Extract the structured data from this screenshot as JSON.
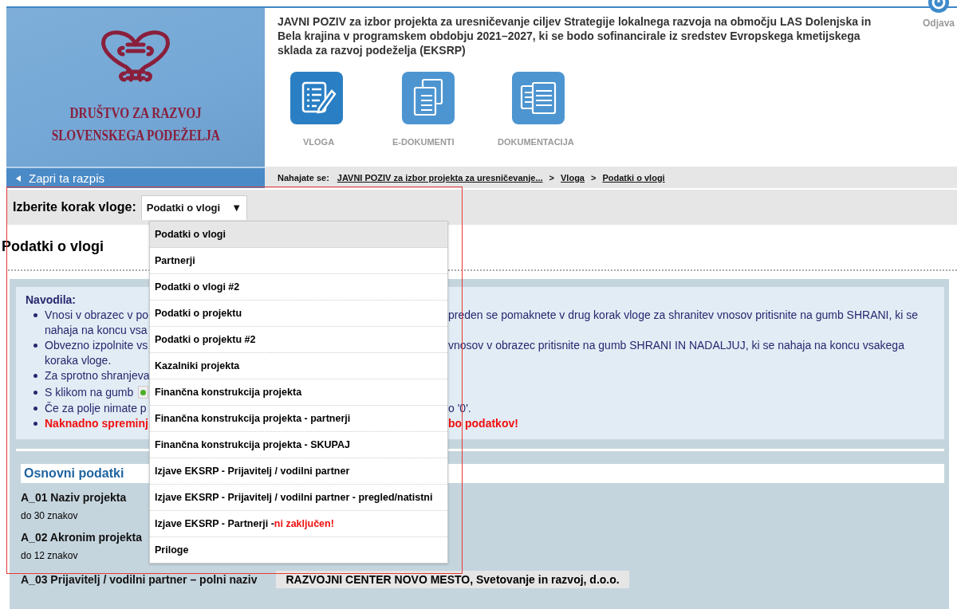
{
  "header": {
    "logo_lines": [
      "DRUŠTVO ZA RAZVOJ",
      "SLOVENSKEGA PODEŽELJA"
    ],
    "title": "JAVNI POZIV za izbor projekta za uresničevanje ciljev Strategije lokalnega razvoja na območju LAS Dolenjska in Bela krajina v programskem obdobju 2021–2027, ki se bodo sofinancirale iz sredstev Evropskega kmetijskega sklada za razvoj podeželja (EKSRP)",
    "nav": [
      {
        "label": "VLOGA",
        "kind": "form"
      },
      {
        "label": "E-DOKUMENTI",
        "kind": "edocs"
      },
      {
        "label": "DOKUMENTACIJA",
        "kind": "docs"
      }
    ],
    "logout": "Odjava"
  },
  "back_link": "Zapri ta razpis",
  "breadcrumb": {
    "label": "Nahajate se:",
    "items": [
      "JAVNI POZIV za izbor projekta za uresničevanje...",
      "Vloga",
      "Podatki o vlogi"
    ],
    "separator": ">"
  },
  "step_select": {
    "label": "Izberite korak vloge:",
    "value": "Podatki o vlogi",
    "arrow": "▼",
    "expanded": true,
    "options": [
      {
        "label": "Podatki o vlogi",
        "selected": true
      },
      {
        "label": "Partnerji",
        "selected": false
      },
      {
        "label": "Podatki o vlogi #2",
        "selected": false
      },
      {
        "label": "Podatki o projektu",
        "selected": false
      },
      {
        "label": "Podatki o projektu #2",
        "selected": false
      },
      {
        "label": "Kazalniki projekta",
        "selected": false
      },
      {
        "label": "Finančna konstrukcija projekta",
        "selected": false
      },
      {
        "label": "Finančna konstrukcija projekta - partnerji",
        "selected": false
      },
      {
        "label": "Finančna konstrukcija projekta - SKUPAJ",
        "selected": false
      },
      {
        "label": "Izjave EKSRP - Prijavitelj / vodilni partner",
        "selected": false
      },
      {
        "label": "Izjave EKSRP - Prijavitelj / vodilni partner - pregled/natistni",
        "selected": false
      },
      {
        "label": "Izjave EKSRP - Partnerji -",
        "note": "ni zaključen!",
        "selected": false
      },
      {
        "label": "Priloge",
        "selected": false
      }
    ]
  },
  "page_title": "Podatki o vlogi",
  "instructions": {
    "title": "Navodila:",
    "lines": [
      {
        "bullet": true,
        "kind": "normal",
        "left": "Vnosi v obrazec v po",
        "right": "preden se pomaknete v drug korak vloge za shranitev vnosov pritisnite na gumb SHRANI, ki se"
      },
      {
        "bullet": false,
        "kind": "normal",
        "left": "nahaja na koncu vsa"
      },
      {
        "bullet": true,
        "kind": "normal",
        "left": "Obvezno izpolnite vs",
        "right": "vnosov v obrazec pritisnite na gumb SHRANI IN NADALJUJ, ki se nahaja na koncu vsakega"
      },
      {
        "bullet": false,
        "kind": "normal",
        "left": "koraka vloge."
      },
      {
        "bullet": true,
        "kind": "normal",
        "left": "Za sprotno shranjeva"
      },
      {
        "bullet": true,
        "kind": "button",
        "left": "S klikom na gumb"
      },
      {
        "bullet": true,
        "kind": "normal",
        "left": "Če za polje nimate p",
        "right": "o '0'."
      },
      {
        "bullet": true,
        "kind": "warning",
        "left": "Naknadno spreminj",
        "right": "bo podatkov!"
      }
    ]
  },
  "section": {
    "title": "Osnovni podatki",
    "fields": [
      {
        "label": "A_01 Naziv projekta",
        "hint": "do 30 znakov"
      },
      {
        "label": "A_02 Akronim projekta",
        "hint": "do 12 znakov"
      },
      {
        "label": "A_03 Prijavitelj / vodilni partner – polni naziv",
        "value": "RAZVOJNI CENTER NOVO MESTO, Svetovanje in razvoj, d.o.o."
      }
    ]
  }
}
